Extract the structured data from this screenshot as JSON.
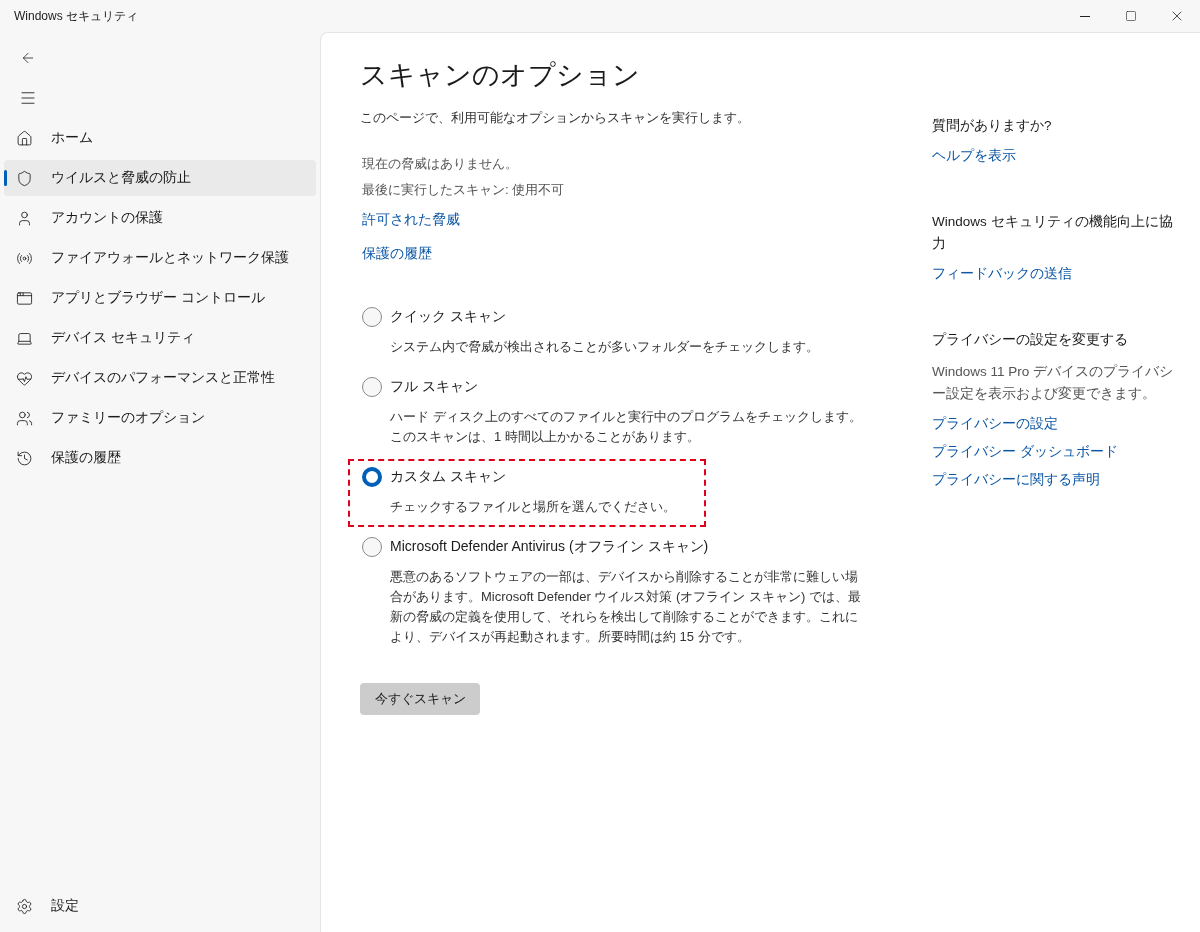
{
  "window": {
    "title": "Windows セキュリティ"
  },
  "sidebar": {
    "items": [
      {
        "kind": "home",
        "label": "ホーム",
        "selected": false
      },
      {
        "kind": "shield",
        "label": "ウイルスと脅威の防止",
        "selected": true
      },
      {
        "kind": "account",
        "label": "アカウントの保護",
        "selected": false
      },
      {
        "kind": "network",
        "label": "ファイアウォールとネットワーク保護",
        "selected": false
      },
      {
        "kind": "app",
        "label": "アプリとブラウザー コントロール",
        "selected": false
      },
      {
        "kind": "device",
        "label": "デバイス セキュリティ",
        "selected": false
      },
      {
        "kind": "health",
        "label": "デバイスのパフォーマンスと正常性",
        "selected": false
      },
      {
        "kind": "family",
        "label": "ファミリーのオプション",
        "selected": false
      },
      {
        "kind": "history",
        "label": "保護の履歴",
        "selected": false
      }
    ],
    "settings": "設定"
  },
  "page": {
    "title": "スキャンのオプション",
    "description": "このページで、利用可能なオプションからスキャンを実行します。",
    "status": [
      "現在の脅威はありません。",
      "最後に実行したスキャン: 使用不可"
    ],
    "links": [
      "許可された脅威",
      "保護の履歴"
    ],
    "options": [
      {
        "label": "クイック スキャン",
        "description": "システム内で脅威が検出されることが多いフォルダーをチェックします。",
        "selected": false,
        "highlighted": false
      },
      {
        "label": "フル スキャン",
        "description": "ハード ディスク上のすべてのファイルと実行中のプログラムをチェックします。このスキャンは、1 時間以上かかることがあります。",
        "selected": false,
        "highlighted": false
      },
      {
        "label": "カスタム スキャン",
        "description": "チェックするファイルと場所を選んでください。",
        "selected": true,
        "highlighted": true
      },
      {
        "label": "Microsoft Defender Antivirus (オフライン スキャン)",
        "description": "悪意のあるソフトウェアの一部は、デバイスから削除することが非常に難しい場合があります。Microsoft Defender ウイルス対策 (オフライン スキャン) では、最新の脅威の定義を使用して、それらを検出して削除することができます。これにより、デバイスが再起動されます。所要時間は約 15 分です。",
        "selected": false,
        "highlighted": false
      }
    ],
    "button": "今すぐスキャン"
  },
  "side_panel": [
    {
      "heading": "質問がありますか?",
      "links": [
        "ヘルプを表示"
      ]
    },
    {
      "heading": "Windows セキュリティの機能向上に協力",
      "links": [
        "フィードバックの送信"
      ]
    },
    {
      "heading": "プライバシーの設定を変更する",
      "text": "Windows 11 Pro デバイスのプライバシー設定を表示および変更できます。",
      "links": [
        "プライバシーの設定",
        "プライバシー ダッシュボード",
        "プライバシーに関する声明"
      ]
    }
  ]
}
